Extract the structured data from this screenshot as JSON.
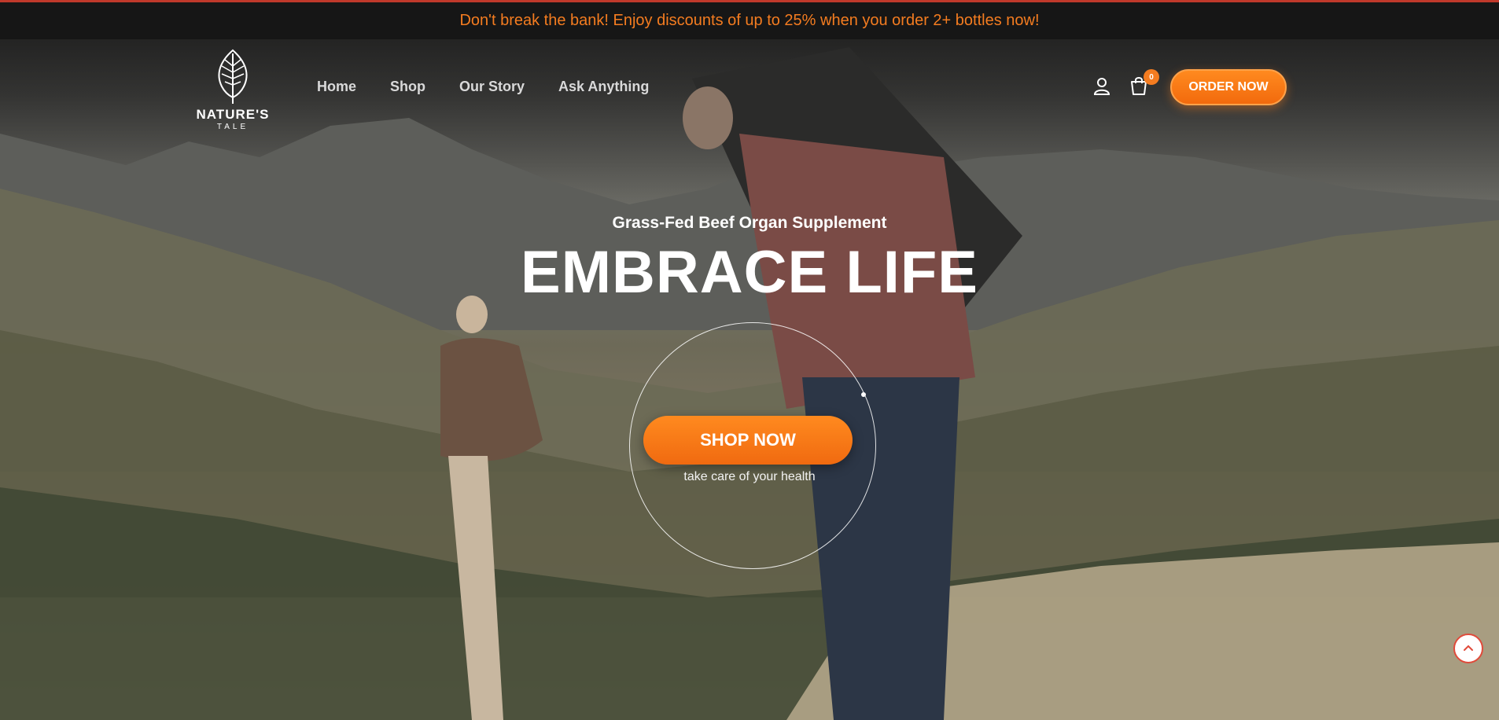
{
  "announcement": {
    "text": "Don't break the bank! Enjoy discounts of up to 25% when you order 2+ bottles now!"
  },
  "logo": {
    "brand": "NATURE'S",
    "sub": "TALE",
    "icon": "leaf-icon"
  },
  "nav": {
    "items": [
      {
        "label": "Home"
      },
      {
        "label": "Shop"
      },
      {
        "label": "Our Story"
      },
      {
        "label": "Ask Anything"
      }
    ]
  },
  "header_actions": {
    "user_icon": "user-icon",
    "cart_icon": "cart-icon",
    "cart_count": "0",
    "order_label": "ORDER NOW"
  },
  "hero": {
    "subtitle": "Grass-Fed Beef Organ Supplement",
    "headline": "EMBRACE LIFE",
    "cta_label": "SHOP NOW",
    "tagline": "take care of your health"
  },
  "scroll_top": {
    "icon": "chevron-up-icon"
  },
  "colors": {
    "accent": "#f47c20",
    "announce_bg": "#161616",
    "top_border": "#c0392b"
  }
}
